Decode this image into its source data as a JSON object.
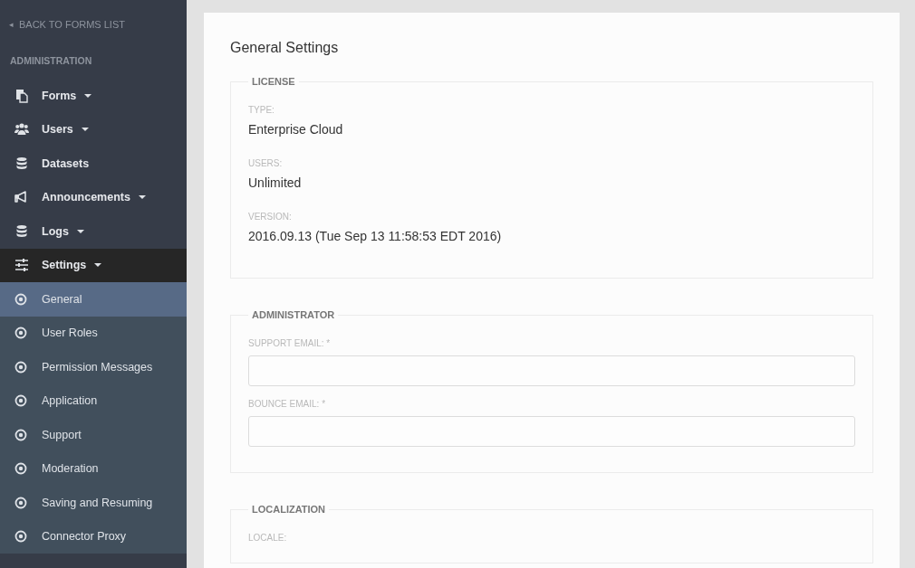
{
  "sidebar": {
    "back_link": {
      "arrow": "◂",
      "label": "BACK TO FORMS LIST"
    },
    "heading": "ADMINISTRATION",
    "items": [
      {
        "label": "Forms",
        "kind": "menu",
        "expanded": false
      },
      {
        "label": "Users",
        "kind": "menu",
        "expanded": false
      },
      {
        "label": "Datasets",
        "kind": "link",
        "expanded": false
      },
      {
        "label": "Announcements",
        "kind": "menu",
        "expanded": false
      },
      {
        "label": "Logs",
        "kind": "menu",
        "expanded": false
      },
      {
        "label": "Settings",
        "kind": "menu",
        "expanded": true,
        "children": [
          {
            "label": "General",
            "selected": true
          },
          {
            "label": "User Roles",
            "selected": false
          },
          {
            "label": "Permission Messages",
            "selected": false
          },
          {
            "label": "Application",
            "selected": false
          },
          {
            "label": "Support",
            "selected": false
          },
          {
            "label": "Moderation",
            "selected": false
          },
          {
            "label": "Saving and Resuming",
            "selected": false
          },
          {
            "label": "Connector Proxy",
            "selected": false
          }
        ]
      }
    ]
  },
  "page": {
    "title": "General Settings",
    "sections": [
      {
        "legend": "LICENSE",
        "fields": [
          {
            "kind": "text",
            "label": "TYPE:",
            "value": "Enterprise Cloud"
          },
          {
            "kind": "text",
            "label": "USERS:",
            "value": "Unlimited"
          },
          {
            "kind": "text",
            "label": "VERSION:",
            "value": "2016.09.13 (Tue Sep 13 11:58:53 EDT 2016)"
          }
        ]
      },
      {
        "legend": "ADMINISTRATOR",
        "fields": [
          {
            "kind": "input",
            "label": "SUPPORT EMAIL: *"
          },
          {
            "kind": "input",
            "label": "BOUNCE EMAIL: *"
          }
        ]
      },
      {
        "legend": "LOCALIZATION",
        "fields": [
          {
            "kind": "label",
            "label": "LOCALE:"
          }
        ]
      }
    ]
  }
}
